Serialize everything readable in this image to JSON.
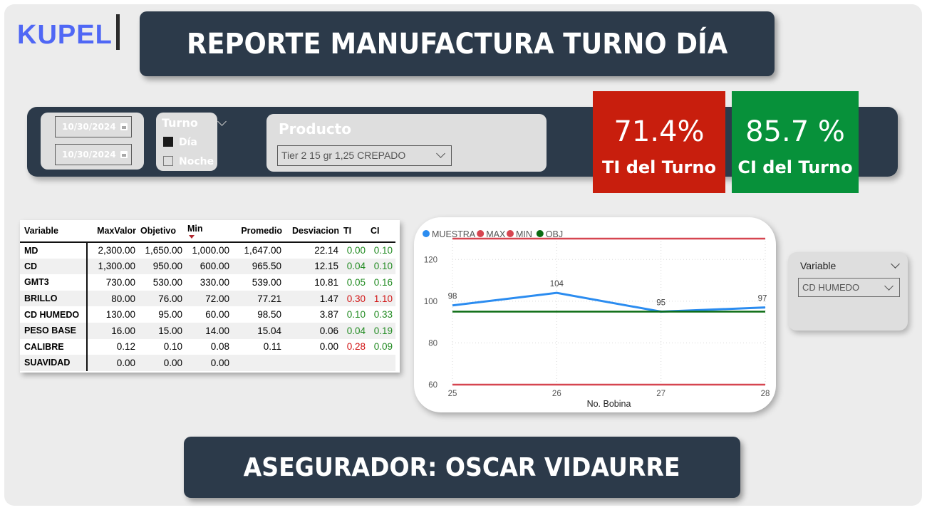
{
  "logo": "KUPEL",
  "title": "REPORTE MANUFACTURA TURNO DÍA",
  "filters": {
    "date_start": "10/30/2024",
    "date_end": "10/30/2024",
    "turno": {
      "title": "Turno",
      "options": [
        {
          "label": "Día",
          "checked": true
        },
        {
          "label": "Noche",
          "checked": false
        }
      ]
    },
    "producto": {
      "title": "Producto",
      "selected": "Tier 2 15 gr 1,25 CREPADO"
    }
  },
  "kpis": {
    "ti": {
      "value": "71.4%",
      "label": "TI del Turno",
      "color": "#c81e0d"
    },
    "ci": {
      "value": "85.7 %",
      "label": "CI del Turno",
      "color": "#07913a"
    }
  },
  "table": {
    "headers": [
      "Variable",
      "MaxValor",
      "Objetivo",
      "Min",
      "Promedio",
      "Desviacion",
      "TI",
      "CI"
    ],
    "rows": [
      {
        "variable": "MD",
        "max": "2,300.00",
        "obj": "1,650.00",
        "min": "1,000.00",
        "prom": "1,647.00",
        "desv": "22.14",
        "ti": "0.00",
        "ci": "0.10",
        "ti_status": "pos",
        "ci_status": "pos"
      },
      {
        "variable": "CD",
        "max": "1,300.00",
        "obj": "950.00",
        "min": "600.00",
        "prom": "965.50",
        "desv": "12.15",
        "ti": "0.04",
        "ci": "0.10",
        "ti_status": "pos",
        "ci_status": "pos"
      },
      {
        "variable": "GMT3",
        "max": "730.00",
        "obj": "530.00",
        "min": "330.00",
        "prom": "539.00",
        "desv": "10.81",
        "ti": "0.05",
        "ci": "0.16",
        "ti_status": "pos",
        "ci_status": "pos"
      },
      {
        "variable": "BRILLO",
        "max": "80.00",
        "obj": "76.00",
        "min": "72.00",
        "prom": "77.21",
        "desv": "1.47",
        "ti": "0.30",
        "ci": "1.10",
        "ti_status": "neg",
        "ci_status": "neg"
      },
      {
        "variable": "CD HUMEDO",
        "max": "130.00",
        "obj": "95.00",
        "min": "60.00",
        "prom": "98.50",
        "desv": "3.87",
        "ti": "0.10",
        "ci": "0.33",
        "ti_status": "pos",
        "ci_status": "pos"
      },
      {
        "variable": "PESO BASE",
        "max": "16.00",
        "obj": "15.00",
        "min": "14.00",
        "prom": "15.04",
        "desv": "0.06",
        "ti": "0.04",
        "ci": "0.19",
        "ti_status": "pos",
        "ci_status": "pos"
      },
      {
        "variable": "CALIBRE",
        "max": "0.12",
        "obj": "0.10",
        "min": "0.08",
        "prom": "0.11",
        "desv": "0.00",
        "ti": "0.28",
        "ci": "0.09",
        "ti_status": "neg",
        "ci_status": "pos"
      },
      {
        "variable": "SUAVIDAD",
        "max": "0.00",
        "obj": "0.00",
        "min": "0.00",
        "prom": "",
        "desv": "",
        "ti": "",
        "ci": "",
        "ti_status": "pos",
        "ci_status": "pos"
      }
    ]
  },
  "chart_data": {
    "type": "line",
    "xlabel": "No. Bobina",
    "ylabel": "",
    "x": [
      25,
      26,
      27,
      28
    ],
    "ylim": [
      60,
      130
    ],
    "yticks": [
      60,
      80,
      100,
      120
    ],
    "legend_position": "top-left",
    "grid": true,
    "series": [
      {
        "name": "MUESTRA",
        "values": [
          98,
          104,
          95,
          97
        ],
        "color": "#2b8cf0",
        "labels": true
      },
      {
        "name": "MAX",
        "values": [
          130,
          130,
          130,
          130
        ],
        "color": "#d64550"
      },
      {
        "name": "MIN",
        "values": [
          60,
          60,
          60,
          60
        ],
        "color": "#d64550"
      },
      {
        "name": "OBJ",
        "values": [
          95,
          95,
          95,
          95
        ],
        "color": "#0a6b12"
      }
    ]
  },
  "variable_slicer": {
    "title": "Variable",
    "selected": "CD HUMEDO"
  },
  "footer": "ASEGURADOR: OSCAR VIDAURRE"
}
